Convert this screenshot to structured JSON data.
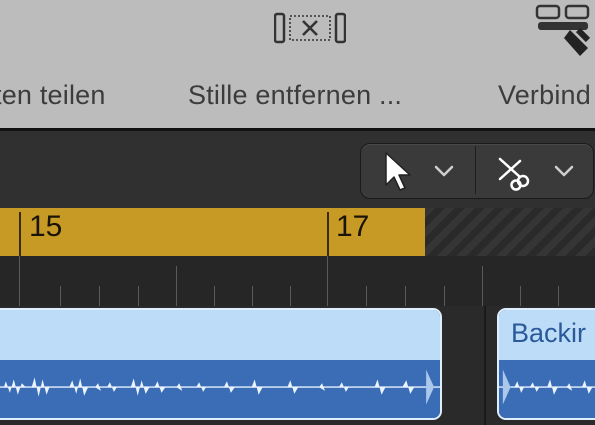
{
  "toolbar": {
    "items": [
      {
        "label": "ten teilen"
      },
      {
        "label": "Stille entfernen ..."
      },
      {
        "label": "Verbind"
      }
    ],
    "icons": [
      "remove-silence-icon",
      "join-regions-icon"
    ]
  },
  "tool_picker": {
    "left_tool": "pointer-tool-icon",
    "right_tool": "scissors-tool-icon"
  },
  "ruler": {
    "bars": [
      {
        "label": "15"
      },
      {
        "label": "17"
      }
    ],
    "cycle_color": "#c79a26"
  },
  "regions": [
    {
      "name": "",
      "color": "#3a6db5"
    },
    {
      "name": "Backir",
      "color": "#3a6db5"
    }
  ]
}
